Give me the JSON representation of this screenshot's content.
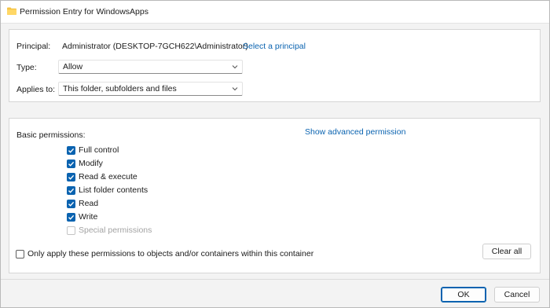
{
  "window": {
    "title": "Permission Entry for WindowsApps",
    "icon": "folder-icon",
    "folder_color": "#f5c343"
  },
  "principal": {
    "label": "Principal:",
    "value": "Administrator (DESKTOP-7GCH622\\Administrator)",
    "link": "Select a principal"
  },
  "type": {
    "label": "Type:",
    "selected": "Allow"
  },
  "applies_to": {
    "label": "Applies to:",
    "selected": "This folder, subfolders and files"
  },
  "basic": {
    "label": "Basic permissions:",
    "advanced_link": "Show advanced permission",
    "items": [
      {
        "label": "Full control",
        "checked": true,
        "enabled": true
      },
      {
        "label": "Modify",
        "checked": true,
        "enabled": true
      },
      {
        "label": "Read & execute",
        "checked": true,
        "enabled": true
      },
      {
        "label": "List folder contents",
        "checked": true,
        "enabled": true
      },
      {
        "label": "Read",
        "checked": true,
        "enabled": true
      },
      {
        "label": "Write",
        "checked": true,
        "enabled": true
      },
      {
        "label": "Special permissions",
        "checked": false,
        "enabled": false
      }
    ]
  },
  "only_apply": {
    "label": "Only apply these permissions to objects and/or containers within this container",
    "checked": false
  },
  "buttons": {
    "clear_all": "Clear all",
    "ok": "OK",
    "cancel": "Cancel"
  },
  "colors": {
    "accent": "#0a63b0",
    "link": "#0a63b0"
  }
}
